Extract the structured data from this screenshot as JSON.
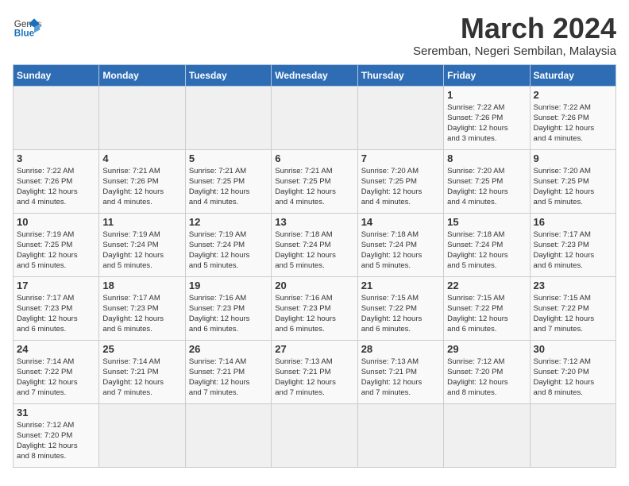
{
  "header": {
    "logo_general": "General",
    "logo_blue": "Blue",
    "title": "March 2024",
    "subtitle": "Seremban, Negeri Sembilan, Malaysia"
  },
  "weekdays": [
    "Sunday",
    "Monday",
    "Tuesday",
    "Wednesday",
    "Thursday",
    "Friday",
    "Saturday"
  ],
  "weeks": [
    [
      {
        "day": "",
        "info": ""
      },
      {
        "day": "",
        "info": ""
      },
      {
        "day": "",
        "info": ""
      },
      {
        "day": "",
        "info": ""
      },
      {
        "day": "",
        "info": ""
      },
      {
        "day": "1",
        "info": "Sunrise: 7:22 AM\nSunset: 7:26 PM\nDaylight: 12 hours\nand 3 minutes."
      },
      {
        "day": "2",
        "info": "Sunrise: 7:22 AM\nSunset: 7:26 PM\nDaylight: 12 hours\nand 4 minutes."
      }
    ],
    [
      {
        "day": "3",
        "info": "Sunrise: 7:22 AM\nSunset: 7:26 PM\nDaylight: 12 hours\nand 4 minutes."
      },
      {
        "day": "4",
        "info": "Sunrise: 7:21 AM\nSunset: 7:26 PM\nDaylight: 12 hours\nand 4 minutes."
      },
      {
        "day": "5",
        "info": "Sunrise: 7:21 AM\nSunset: 7:25 PM\nDaylight: 12 hours\nand 4 minutes."
      },
      {
        "day": "6",
        "info": "Sunrise: 7:21 AM\nSunset: 7:25 PM\nDaylight: 12 hours\nand 4 minutes."
      },
      {
        "day": "7",
        "info": "Sunrise: 7:20 AM\nSunset: 7:25 PM\nDaylight: 12 hours\nand 4 minutes."
      },
      {
        "day": "8",
        "info": "Sunrise: 7:20 AM\nSunset: 7:25 PM\nDaylight: 12 hours\nand 4 minutes."
      },
      {
        "day": "9",
        "info": "Sunrise: 7:20 AM\nSunset: 7:25 PM\nDaylight: 12 hours\nand 5 minutes."
      }
    ],
    [
      {
        "day": "10",
        "info": "Sunrise: 7:19 AM\nSunset: 7:25 PM\nDaylight: 12 hours\nand 5 minutes."
      },
      {
        "day": "11",
        "info": "Sunrise: 7:19 AM\nSunset: 7:24 PM\nDaylight: 12 hours\nand 5 minutes."
      },
      {
        "day": "12",
        "info": "Sunrise: 7:19 AM\nSunset: 7:24 PM\nDaylight: 12 hours\nand 5 minutes."
      },
      {
        "day": "13",
        "info": "Sunrise: 7:18 AM\nSunset: 7:24 PM\nDaylight: 12 hours\nand 5 minutes."
      },
      {
        "day": "14",
        "info": "Sunrise: 7:18 AM\nSunset: 7:24 PM\nDaylight: 12 hours\nand 5 minutes."
      },
      {
        "day": "15",
        "info": "Sunrise: 7:18 AM\nSunset: 7:24 PM\nDaylight: 12 hours\nand 5 minutes."
      },
      {
        "day": "16",
        "info": "Sunrise: 7:17 AM\nSunset: 7:23 PM\nDaylight: 12 hours\nand 6 minutes."
      }
    ],
    [
      {
        "day": "17",
        "info": "Sunrise: 7:17 AM\nSunset: 7:23 PM\nDaylight: 12 hours\nand 6 minutes."
      },
      {
        "day": "18",
        "info": "Sunrise: 7:17 AM\nSunset: 7:23 PM\nDaylight: 12 hours\nand 6 minutes."
      },
      {
        "day": "19",
        "info": "Sunrise: 7:16 AM\nSunset: 7:23 PM\nDaylight: 12 hours\nand 6 minutes."
      },
      {
        "day": "20",
        "info": "Sunrise: 7:16 AM\nSunset: 7:23 PM\nDaylight: 12 hours\nand 6 minutes."
      },
      {
        "day": "21",
        "info": "Sunrise: 7:15 AM\nSunset: 7:22 PM\nDaylight: 12 hours\nand 6 minutes."
      },
      {
        "day": "22",
        "info": "Sunrise: 7:15 AM\nSunset: 7:22 PM\nDaylight: 12 hours\nand 6 minutes."
      },
      {
        "day": "23",
        "info": "Sunrise: 7:15 AM\nSunset: 7:22 PM\nDaylight: 12 hours\nand 7 minutes."
      }
    ],
    [
      {
        "day": "24",
        "info": "Sunrise: 7:14 AM\nSunset: 7:22 PM\nDaylight: 12 hours\nand 7 minutes."
      },
      {
        "day": "25",
        "info": "Sunrise: 7:14 AM\nSunset: 7:21 PM\nDaylight: 12 hours\nand 7 minutes."
      },
      {
        "day": "26",
        "info": "Sunrise: 7:14 AM\nSunset: 7:21 PM\nDaylight: 12 hours\nand 7 minutes."
      },
      {
        "day": "27",
        "info": "Sunrise: 7:13 AM\nSunset: 7:21 PM\nDaylight: 12 hours\nand 7 minutes."
      },
      {
        "day": "28",
        "info": "Sunrise: 7:13 AM\nSunset: 7:21 PM\nDaylight: 12 hours\nand 7 minutes."
      },
      {
        "day": "29",
        "info": "Sunrise: 7:12 AM\nSunset: 7:20 PM\nDaylight: 12 hours\nand 8 minutes."
      },
      {
        "day": "30",
        "info": "Sunrise: 7:12 AM\nSunset: 7:20 PM\nDaylight: 12 hours\nand 8 minutes."
      }
    ],
    [
      {
        "day": "31",
        "info": "Sunrise: 7:12 AM\nSunset: 7:20 PM\nDaylight: 12 hours\nand 8 minutes."
      },
      {
        "day": "",
        "info": ""
      },
      {
        "day": "",
        "info": ""
      },
      {
        "day": "",
        "info": ""
      },
      {
        "day": "",
        "info": ""
      },
      {
        "day": "",
        "info": ""
      },
      {
        "day": "",
        "info": ""
      }
    ]
  ]
}
